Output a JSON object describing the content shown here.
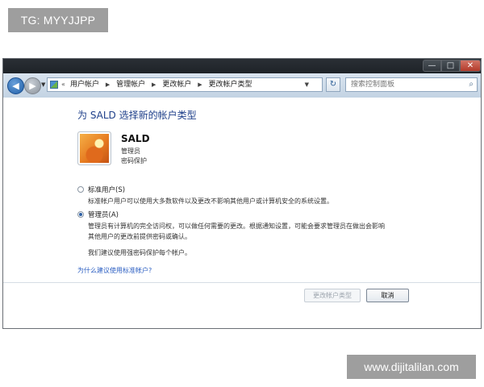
{
  "overlay": {
    "tg_label": "TG: MYYJJPP",
    "watermark": "www.dijitalilan.com"
  },
  "window": {
    "controls": {
      "minimize": "—",
      "maximize": "□",
      "close": "✕"
    }
  },
  "nav": {
    "breadcrumb_prefix": "«",
    "breadcrumbs": [
      "用户帐户",
      "管理帐户",
      "更改帐户",
      "更改帐户类型"
    ],
    "search_placeholder": "搜索控制面板",
    "icons": {
      "back": "back-arrow-icon",
      "forward": "forward-arrow-icon",
      "search": "search-icon",
      "go": "refresh-icon"
    }
  },
  "page": {
    "title": "为 SALD 选择新的帐户类型",
    "account": {
      "name": "SALD",
      "role": "管理员",
      "status": "密码保护"
    },
    "options": [
      {
        "label": "标准用户(S)",
        "description": "标准帐户用户可以使用大多数软件以及更改不影响其他用户或计算机安全的系统设置。",
        "selected": false
      },
      {
        "label": "管理员(A)",
        "description_line1": "管理员有计算机的完全访问权，可以做任何需要的更改。根据通知设置，可能会要求管理员在做出会影响",
        "description_line2": "其他用户的更改前提供密码或确认。",
        "selected": true
      }
    ],
    "recommendation": "我们建议使用强密码保护每个帐户。",
    "help_link": "为什么建议使用标准帐户?",
    "buttons": {
      "change": "更改帐户类型",
      "cancel": "取消"
    }
  }
}
